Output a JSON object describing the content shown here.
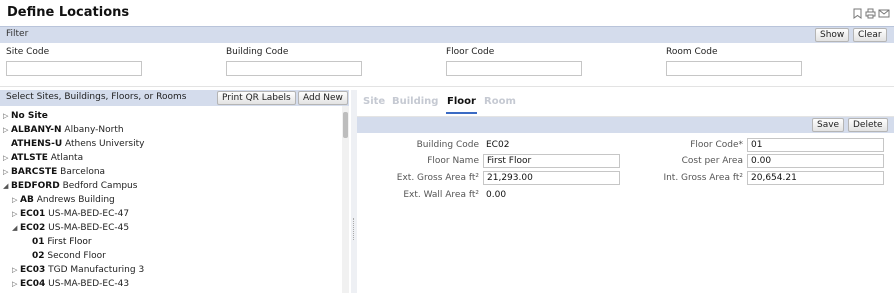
{
  "page": {
    "title": "Define Locations"
  },
  "title_icons": [
    "bookmark-icon",
    "print-icon",
    "email-icon"
  ],
  "filter": {
    "label": "Filter",
    "show_label": "Show",
    "clear_label": "Clear",
    "fields": [
      {
        "label": "Site Code",
        "value": ""
      },
      {
        "label": "Building Code",
        "value": ""
      },
      {
        "label": "Floor Code",
        "value": ""
      },
      {
        "label": "Room Code",
        "value": ""
      }
    ]
  },
  "tree_panel": {
    "title": "Select Sites, Buildings, Floors, or Rooms",
    "print_qr_label": "Print QR Labels",
    "add_new_label": "Add New",
    "items": [
      {
        "toggle": "▷",
        "code": "No Site",
        "name": ""
      },
      {
        "toggle": "▷",
        "code": "ALBANY-N",
        "name": "Albany-North"
      },
      {
        "toggle": "",
        "code": "ATHENS-U",
        "name": "Athens University"
      },
      {
        "toggle": "▷",
        "code": "ATLSTE",
        "name": "Atlanta"
      },
      {
        "toggle": "▷",
        "code": "BARCSTE",
        "name": "Barcelona"
      },
      {
        "toggle": "◢",
        "code": "BEDFORD",
        "name": "Bedford Campus"
      },
      {
        "toggle": "▷",
        "code": "AB",
        "name": "Andrews Building"
      },
      {
        "toggle": "▷",
        "code": "EC01",
        "name": "US-MA-BED-EC-47"
      },
      {
        "toggle": "◢",
        "code": "EC02",
        "name": "US-MA-BED-EC-45"
      },
      {
        "toggle": "",
        "code": "01",
        "name": "First Floor"
      },
      {
        "toggle": "",
        "code": "02",
        "name": "Second Floor"
      },
      {
        "toggle": "▷",
        "code": "EC03",
        "name": "TGD Manufacturing 3"
      },
      {
        "toggle": "▷",
        "code": "EC04",
        "name": "US-MA-BED-EC-43"
      }
    ]
  },
  "detail_panel": {
    "tabs": [
      {
        "label": "Site",
        "active": false
      },
      {
        "label": "Building",
        "active": false
      },
      {
        "label": "Floor",
        "active": true
      },
      {
        "label": "Room",
        "active": false
      }
    ],
    "save_label": "Save",
    "delete_label": "Delete",
    "fields": {
      "building_code": {
        "label": "Building Code",
        "value": "EC02"
      },
      "floor_code": {
        "label": "Floor Code*",
        "value": "01"
      },
      "floor_name": {
        "label": "Floor Name",
        "value": "First Floor"
      },
      "cost_per_area": {
        "label": "Cost per Area",
        "value": "0.00"
      },
      "ext_gross_area": {
        "label": "Ext. Gross Area ft²",
        "value": "21,293.00"
      },
      "int_gross_area": {
        "label": "Int. Gross Area ft²",
        "value": "20,654.21"
      },
      "ext_wall_area": {
        "label": "Ext. Wall Area ft²",
        "value": "0.00"
      }
    }
  },
  "colors": {
    "header_band": "#d4dcec",
    "active_tab_underline": "#3b6bc4",
    "inactive_tab": "#c5c9d2"
  }
}
